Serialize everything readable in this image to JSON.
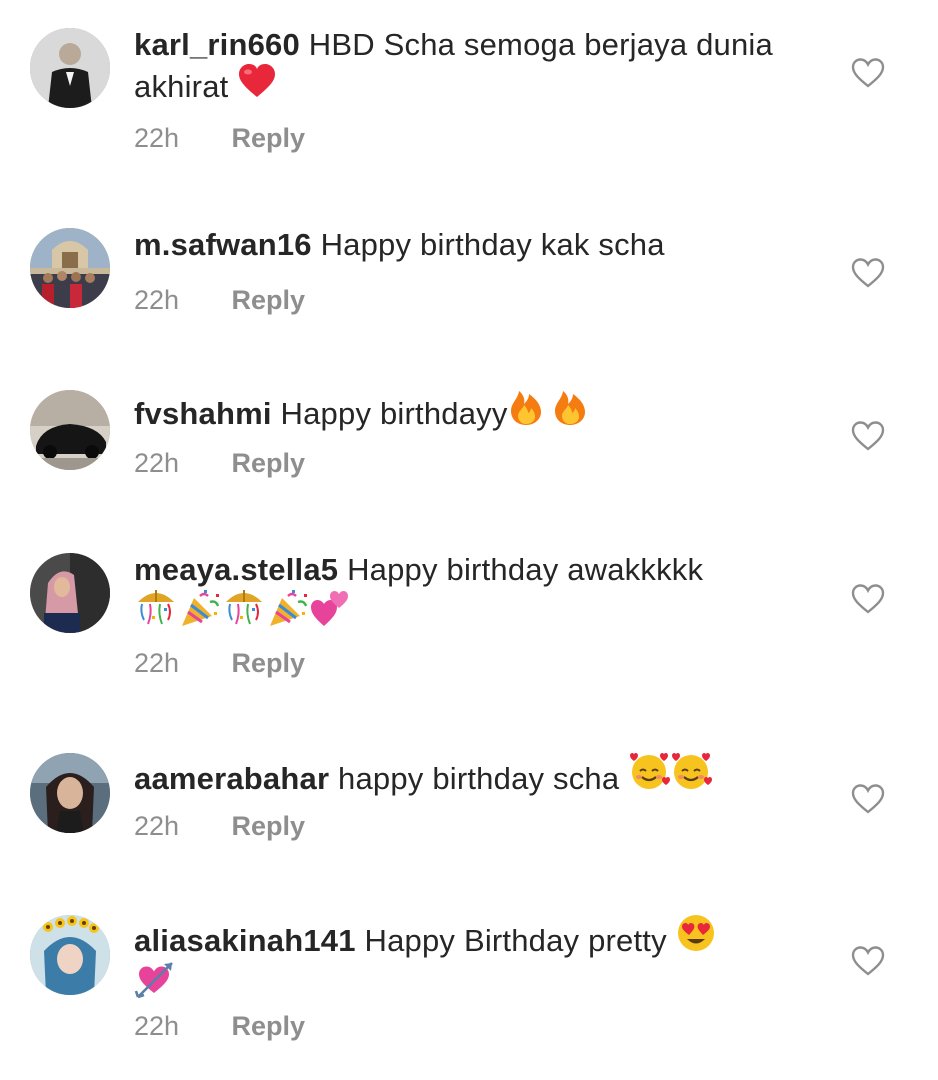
{
  "colors": {
    "username": "#262626",
    "body_text": "#262626",
    "meta_text": "#8e8e8e",
    "heart_outline": "#8e8e8e",
    "red_heart": "#e8283a",
    "fire": "#f57c10",
    "pink_heart": "#e8439a"
  },
  "comments": [
    {
      "username": "karl_rin660",
      "text": "HBD Scha semoga berjaya dunia akhirat",
      "emojis": [
        "red-heart"
      ],
      "time": "22h",
      "reply_label": "Reply",
      "like_icon": "heart-outline-icon"
    },
    {
      "username": "m.safwan16",
      "text": "Happy birthday kak scha",
      "emojis": [],
      "time": "22h",
      "reply_label": "Reply",
      "like_icon": "heart-outline-icon"
    },
    {
      "username": "fvshahmi",
      "text": "Happy birthdayy",
      "emojis": [
        "fire",
        "fire"
      ],
      "time": "22h",
      "reply_label": "Reply",
      "like_icon": "heart-outline-icon"
    },
    {
      "username": "meaya.stella5",
      "text": "Happy birthday awakkkkk",
      "emojis": [
        "confetti-ball",
        "party-popper",
        "confetti-ball",
        "party-popper",
        "two-hearts"
      ],
      "time": "22h",
      "reply_label": "Reply",
      "like_icon": "heart-outline-icon"
    },
    {
      "username": "aamerabahar",
      "text": "happy birthday scha",
      "emojis": [
        "smiling-face-with-hearts",
        "smiling-face-with-hearts"
      ],
      "time": "22h",
      "reply_label": "Reply",
      "like_icon": "heart-outline-icon"
    },
    {
      "username": "aliasakinah141",
      "text": "Happy Birthday pretty",
      "emojis": [
        "heart-eyes",
        "heart-with-arrow"
      ],
      "time": "22h",
      "reply_label": "Reply",
      "like_icon": "heart-outline-icon"
    }
  ]
}
